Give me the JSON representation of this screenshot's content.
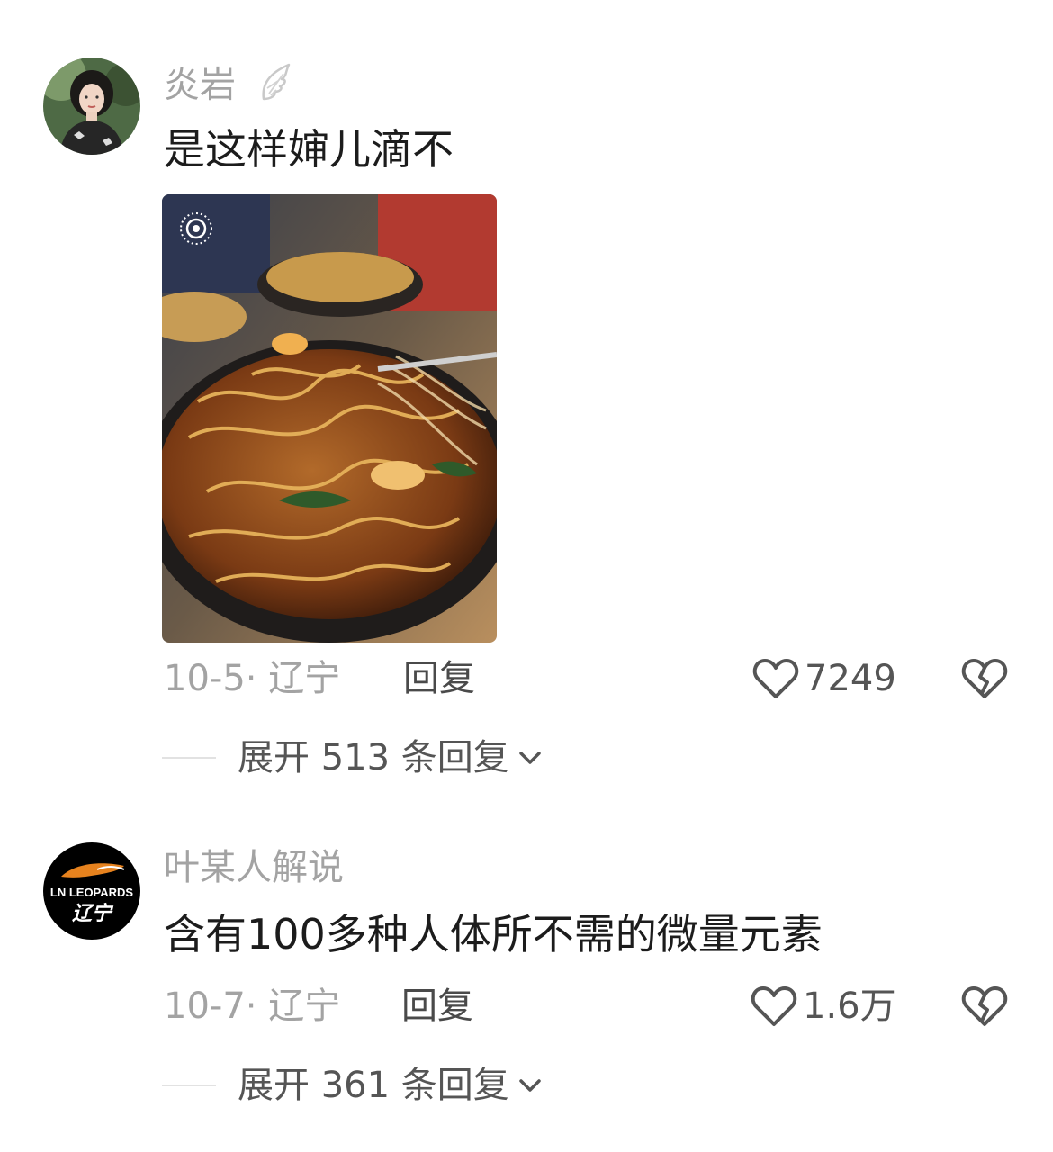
{
  "comments": [
    {
      "username": "炎岩",
      "text": "是这样婶儿滴不",
      "date_location": "10-5· 辽宁",
      "reply_label": "回复",
      "likes": "7249",
      "expand_label": "展开 513 条回复",
      "avatar_icon": "avatar-woman-cheongsam",
      "badge_icon": "wing-icon",
      "has_image": true
    },
    {
      "username": "叶某人解说",
      "text": "含有100多种人体所不需的微量元素",
      "date_location": "10-7· 辽宁",
      "reply_label": "回复",
      "likes": "1.6万",
      "expand_label": "展开 361 条回复",
      "avatar_icon": "avatar-ln-leopards-logo",
      "avatar_logo_text": "LN LEOPARDS 辽宁"
    }
  ],
  "colors": {
    "username": "#a3a3a3",
    "text": "#1c1c1c",
    "meta": "#a3a3a3",
    "action": "#4a4a4a",
    "divider": "#e2e2e2"
  }
}
